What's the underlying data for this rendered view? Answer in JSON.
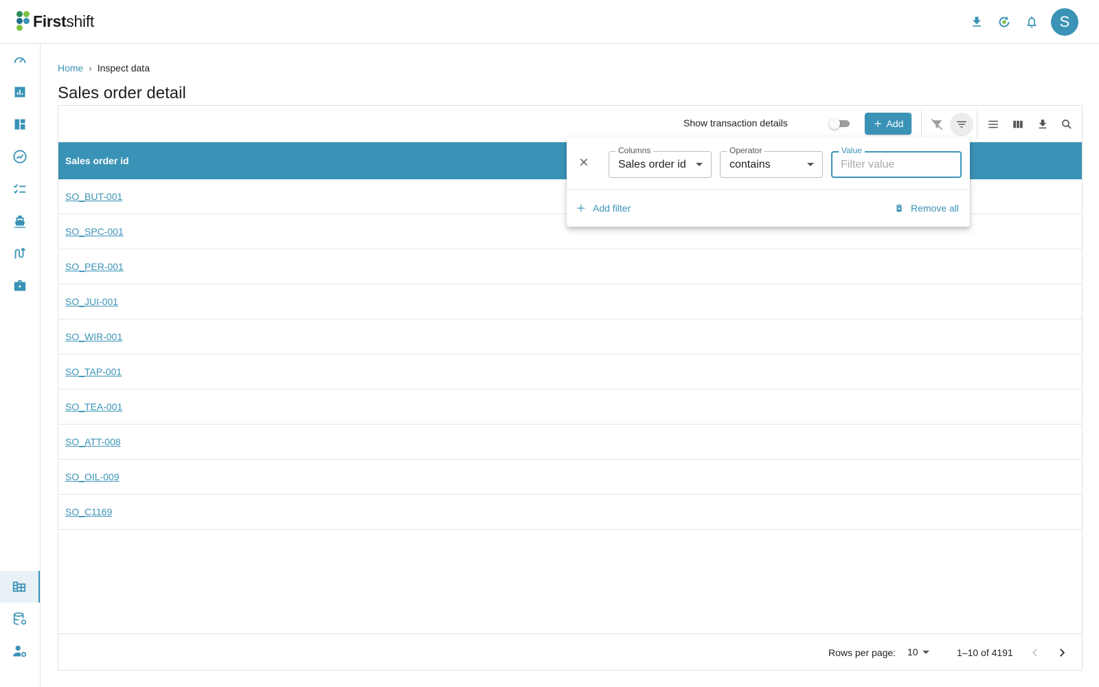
{
  "app": {
    "brand_bold": "First",
    "brand_light": "shift",
    "avatar_initial": "S"
  },
  "topbar": {
    "icons": [
      "download-icon",
      "sync-icon",
      "bell-icon"
    ]
  },
  "sidebar": {
    "items": [
      {
        "icon": "speedometer-icon"
      },
      {
        "icon": "bar-chart-icon"
      },
      {
        "icon": "dashboard-icon"
      },
      {
        "icon": "trend-icon"
      },
      {
        "icon": "checklist-icon"
      },
      {
        "icon": "ship-icon"
      },
      {
        "icon": "route-icon"
      },
      {
        "icon": "briefcase-icon"
      },
      {
        "icon": "building-table-icon",
        "active": true
      },
      {
        "icon": "database-settings-icon"
      },
      {
        "icon": "user-settings-icon"
      }
    ]
  },
  "breadcrumb": {
    "home": "Home",
    "separator": "›",
    "current": "Inspect data"
  },
  "page": {
    "title": "Sales order detail"
  },
  "toolbar": {
    "toggle_label": "Show transaction details",
    "toggle_on": false,
    "add_label": "Add",
    "icons": [
      "clear-filter-icon",
      "filter-icon",
      "density-icon",
      "columns-icon",
      "export-icon",
      "search-icon"
    ]
  },
  "table": {
    "columns": [
      "Sales order id"
    ],
    "rows": [
      "SO_BUT-001",
      "SO_SPC-001",
      "SO_PER-001",
      "SO_JUI-001",
      "SO_WIR-001",
      "SO_TAP-001",
      "SO_TEA-001",
      "SO_ATT-008",
      "SO_OIL-009",
      "SO_C1169"
    ]
  },
  "pagination": {
    "rows_per_page_label": "Rows per page:",
    "rows_per_page": "10",
    "range": "1–10 of 4191"
  },
  "filter_panel": {
    "columns_label": "Columns",
    "columns_value": "Sales order id",
    "operator_label": "Operator",
    "operator_value": "contains",
    "value_label": "Value",
    "value_placeholder": "Filter value",
    "add_filter": "Add filter",
    "remove_all": "Remove all"
  },
  "colors": {
    "accent": "#3a93b6",
    "logo_green": "#7cc242",
    "logo_teal": "#1f6f8b"
  }
}
